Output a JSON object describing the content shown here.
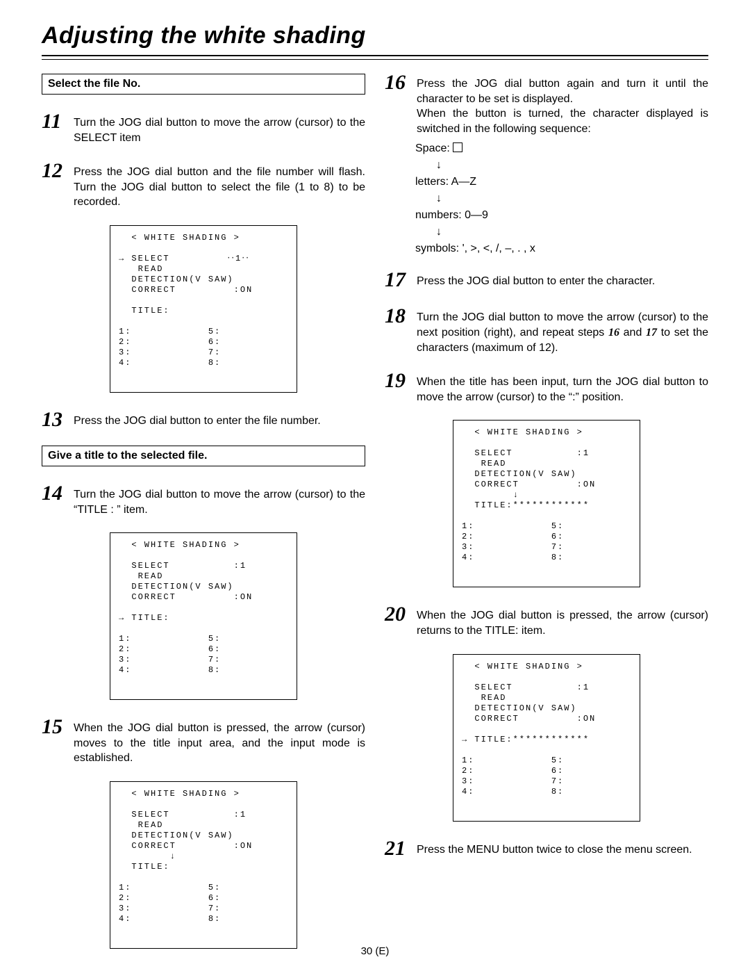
{
  "page": {
    "title": "Adjusting the white shading",
    "number": "30 (E)"
  },
  "left": {
    "subhead1": "Select the file No.",
    "subhead2": "Give a title to the selected file.",
    "steps": {
      "s11": {
        "num": "11",
        "text": "Turn the JOG dial button to move the arrow (cursor) to the SELECT item"
      },
      "s12": {
        "num": "12",
        "text": "Press the JOG dial button and the file number will flash.  Turn the JOG dial button to select the file (1 to 8) to be recorded."
      },
      "s13": {
        "num": "13",
        "text": "Press the JOG dial button to enter the file number."
      },
      "s14": {
        "num": "14",
        "text": "Turn the JOG dial button to move the arrow (cursor) to the “TITLE : ” item."
      },
      "s15": {
        "num": "15",
        "text": "When the JOG dial button is pressed, the arrow (cursor) moves to the title input area, and the input mode is established."
      }
    }
  },
  "right": {
    "steps": {
      "s16": {
        "num": "16",
        "text1": "Press the JOG dial button again and turn it until the character to be set is displayed.",
        "text2": "When the button is turned, the character displayed is switched in the following sequence:"
      },
      "s17": {
        "num": "17",
        "text": "Press the JOG dial button to enter the character."
      },
      "s18": {
        "num": "18",
        "text": "Turn the JOG dial button to move the arrow (cursor) to the next position (right), and repeat steps 16 and 17 to set the characters (maximum of 12)."
      },
      "s19": {
        "num": "19",
        "text": "When the title has been input, turn the JOG dial button to move the arrow (cursor) to the “:” position."
      },
      "s20": {
        "num": "20",
        "text": "When the JOG dial button is pressed, the arrow (cursor) returns to the TITLE: item."
      },
      "s21": {
        "num": "21",
        "text": "Press the MENU button twice to close the menu screen."
      }
    },
    "seq": {
      "space": "Space: ",
      "letters": "letters: A—Z",
      "numbers": "numbers: 0—9",
      "symbols": "symbols: ', >, <, /, –, . , x"
    }
  },
  "screens": {
    "s12": "  < WHITE SHADING >\n\n→ SELECT         ‧‧1‧‧\n   READ\n  DETECTION(V SAW)\n  CORRECT         :ON\n\n  TITLE:\n\n1:            5:\n2:            6:\n3:            7:\n4:            8:",
    "s14": "  < WHITE SHADING >\n\n  SELECT          :1\n   READ\n  DETECTION(V SAW)\n  CORRECT         :ON\n\n→ TITLE:\n\n1:            5:\n2:            6:\n3:            7:\n4:            8:",
    "s15": "  < WHITE SHADING >\n\n  SELECT          :1\n   READ\n  DETECTION(V SAW)\n  CORRECT         :ON\n        ↓\n  TITLE:\n\n1:            5:\n2:            6:\n3:            7:\n4:            8:",
    "s19": "  < WHITE SHADING >\n\n  SELECT          :1\n   READ\n  DETECTION(V SAW)\n  CORRECT         :ON\n        ↓\n  TITLE:************\n\n1:            5:\n2:            6:\n3:            7:\n4:            8:",
    "s20": "  < WHITE SHADING >\n\n  SELECT          :1\n   READ\n  DETECTION(V SAW)\n  CORRECT         :ON\n\n→ TITLE:************\n\n1:            5:\n2:            6:\n3:            7:\n4:            8:"
  }
}
